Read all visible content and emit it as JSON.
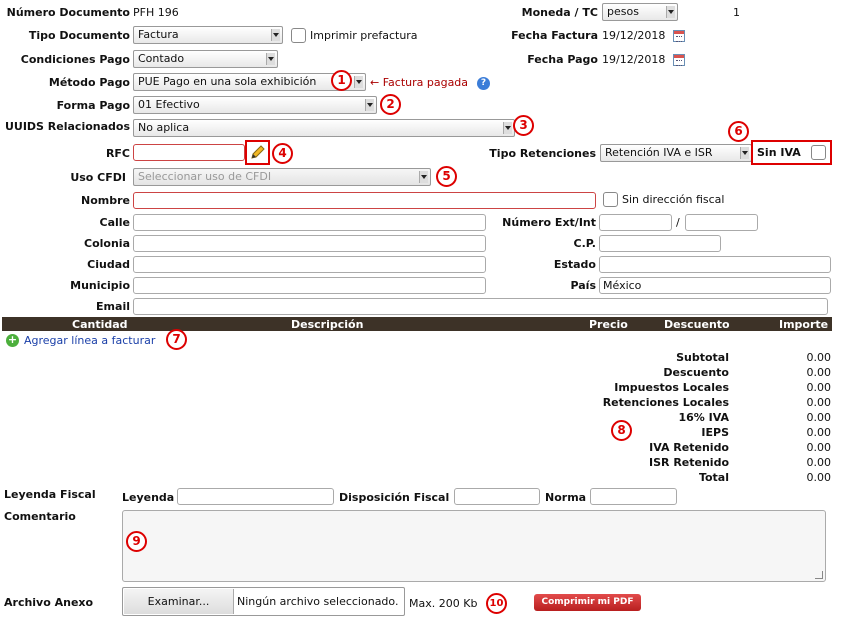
{
  "header": {
    "numero_documento_label": "Número Documento",
    "numero_documento_value": "PFH 196",
    "moneda_label": "Moneda / TC",
    "moneda_value": "pesos",
    "tc_value": "1",
    "tipo_documento_label": "Tipo Documento",
    "tipo_documento_value": "Factura",
    "imprimir_prefactura_label": "Imprimir prefactura",
    "fecha_factura_label": "Fecha Factura",
    "fecha_factura_value": "19/12/2018",
    "condiciones_pago_label": "Condiciones Pago",
    "condiciones_pago_value": "Contado",
    "fecha_pago_label": "Fecha Pago",
    "fecha_pago_value": "19/12/2018",
    "metodo_pago_label": "Método Pago",
    "metodo_pago_value": "PUE Pago en una sola exhibición",
    "factura_pagada_text": "← Factura pagada",
    "forma_pago_label": "Forma Pago",
    "forma_pago_value": "01 Efectivo",
    "uuids_label": "UUIDS Relacionados",
    "uuids_value": "No aplica",
    "rfc_label": "RFC",
    "tipo_retenciones_label": "Tipo Retenciones",
    "tipo_retenciones_value": "Retención IVA e ISR",
    "sin_iva_label": "Sin IVA",
    "uso_cfdi_label": "Uso CFDI",
    "uso_cfdi_placeholder": "Seleccionar uso de CFDI"
  },
  "address": {
    "nombre_label": "Nombre",
    "sin_direccion_label": "Sin dirección fiscal",
    "calle_label": "Calle",
    "numero_label": "Número Ext/Int",
    "numero_sep": "/",
    "colonia_label": "Colonia",
    "cp_label": "C.P.",
    "ciudad_label": "Ciudad",
    "estado_label": "Estado",
    "municipio_label": "Municipio",
    "pais_label": "País",
    "pais_value": "México",
    "email_label": "Email"
  },
  "table": {
    "columns": [
      "Cantidad",
      "Descripción",
      "Precio",
      "Descuento",
      "Importe"
    ],
    "add_line_label": "Agregar línea a facturar"
  },
  "totals": [
    {
      "label": "Subtotal",
      "value": "0.00"
    },
    {
      "label": "Descuento",
      "value": "0.00"
    },
    {
      "label": "Impuestos Locales",
      "value": "0.00"
    },
    {
      "label": "Retenciones Locales",
      "value": "0.00"
    },
    {
      "label": "16% IVA",
      "value": "0.00"
    },
    {
      "label": "IEPS",
      "value": "0.00"
    },
    {
      "label": "IVA Retenido",
      "value": "0.00"
    },
    {
      "label": "ISR Retenido",
      "value": "0.00"
    },
    {
      "label": "Total",
      "value": "0.00"
    }
  ],
  "footer": {
    "leyenda_fiscal_label": "Leyenda Fiscal",
    "leyenda_label": "Leyenda",
    "disposicion_label": "Disposición Fiscal",
    "norma_label": "Norma",
    "comentario_label": "Comentario",
    "archivo_label": "Archivo Anexo",
    "examinar_label": "Examinar...",
    "ningun_archivo_text": "Ningún archivo seleccionado.",
    "max_text": "Max. 200 Kb",
    "comprimir_label": "Comprimir mi PDF"
  },
  "markers": [
    "1",
    "2",
    "3",
    "4",
    "5",
    "6",
    "7",
    "8",
    "9",
    "10"
  ],
  "colors": {
    "accent": "#d00000",
    "header_bg": "#3d3227",
    "link": "#1a3fa8"
  }
}
